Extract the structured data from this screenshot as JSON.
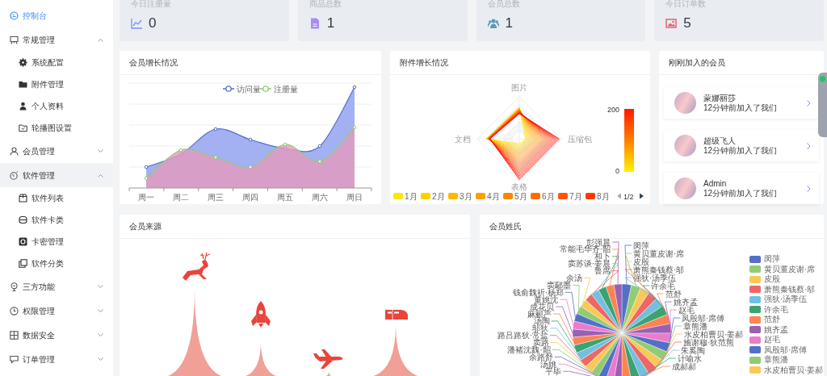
{
  "sidebar": {
    "items": [
      {
        "label": "控制台",
        "selected": true,
        "hovered": false
      },
      {
        "label": "常规管理",
        "selected": false,
        "hovered": false,
        "expanded": true,
        "children": [
          {
            "label": "系统配置",
            "selected": false
          },
          {
            "label": "附件管理",
            "selected": false
          },
          {
            "label": "个人资料",
            "selected": false
          },
          {
            "label": "轮播图设置",
            "selected": false
          }
        ]
      },
      {
        "label": "会员管理",
        "selected": false,
        "hovered": false,
        "expanded": false
      },
      {
        "label": "软件管理",
        "selected": false,
        "hovered": true,
        "expanded": true,
        "children": [
          {
            "label": "软件列表",
            "selected": false
          },
          {
            "label": "软件卡类",
            "selected": false
          },
          {
            "label": "卡密管理",
            "selected": false
          },
          {
            "label": "软件分类",
            "selected": false
          }
        ]
      },
      {
        "label": "三方功能",
        "selected": false,
        "hovered": false,
        "expanded": false
      },
      {
        "label": "权限管理",
        "selected": false,
        "hovered": false,
        "expanded": false
      },
      {
        "label": "数据安全",
        "selected": false,
        "hovered": false,
        "expanded": false
      },
      {
        "label": "订单管理",
        "selected": false,
        "hovered": false,
        "expanded": false
      }
    ]
  },
  "stats": [
    {
      "title": "今日注册量",
      "value": "0"
    },
    {
      "title": "商品总数",
      "value": "1"
    },
    {
      "title": "会员总数",
      "value": "1"
    },
    {
      "title": "今日订单数",
      "value": "5"
    }
  ],
  "member_growth": {
    "title": "会员增长情况",
    "legend": [
      {
        "label": "访问量",
        "color": "#5470c6"
      },
      {
        "label": "注册量",
        "color": "#91cc75"
      }
    ],
    "categories": [
      "周一",
      "周二",
      "周三",
      "周四",
      "周五",
      "周六",
      "周日"
    ]
  },
  "attachment_growth": {
    "title": "附件增长情况",
    "indicators": [
      "图片",
      "压缩包",
      "表格",
      "文档"
    ],
    "visual_map": {
      "max": "200",
      "min": "0"
    },
    "legend": [
      {
        "label": "1月",
        "color": "#ffe600"
      },
      {
        "label": "2月",
        "color": "#ffd000"
      },
      {
        "label": "3月",
        "color": "#ffb800"
      },
      {
        "label": "4月",
        "color": "#ff9f00"
      },
      {
        "label": "5月",
        "color": "#ff8600"
      },
      {
        "label": "6月",
        "color": "#ff6d00"
      },
      {
        "label": "7月",
        "color": "#ff5500"
      },
      {
        "label": "8月",
        "color": "#ff3a00"
      }
    ],
    "legend_page": "1/2"
  },
  "new_members": {
    "title": "刚刚加入的会员",
    "items": [
      {
        "name": "蒙娜丽莎",
        "note": "12分钟前加入了我们"
      },
      {
        "name": "超级飞人",
        "note": "12分钟前加入了我们"
      },
      {
        "name": "Admin",
        "note": "12分钟前加入了我们"
      }
    ]
  },
  "member_sources": {
    "title": "会员来源"
  },
  "member_surnames": {
    "title": "会员姓氏",
    "labels_right": [
      "闵萍",
      "黄贝董皮谢·席",
      "皮殷",
      "萧熊秦钱蔡·邬",
      "强狄·汤季伍",
      "许余毛",
      "范舒",
      "姚齐孟",
      "赵毛",
      "凤殷邬·席傅",
      "章熊潘",
      "水皮柏曹贝·姜郝",
      "施谢穆·狄范熊",
      "朱奚陶",
      "计喻水",
      "成郝郝"
    ],
    "labels_left": [
      "彭强晨",
      "常能毛华齐·韶",
      "和卜",
      "窦苏谈·姜晨",
      "鲁席",
      "余汤",
      "窦鄢墨",
      "钱俞魏祈·杨郑",
      "董姚沈",
      "成花贝",
      "麻郦严",
      "汤陶",
      "邬狄",
      "路吕路狄·常盐",
      "窦路",
      "潘褚沈魏·韶",
      "余路舒",
      "汤姚",
      "平毕"
    ],
    "legend": [
      {
        "name": "闵萍",
        "color": "#5470c6"
      },
      {
        "name": "黄贝董皮谢·席",
        "color": "#91cc75"
      },
      {
        "name": "皮殷",
        "color": "#fac858"
      },
      {
        "name": "萧熊秦钱蔡·邬",
        "color": "#ee6666"
      },
      {
        "name": "强狄·汤季伍",
        "color": "#73c0de"
      },
      {
        "name": "许余毛",
        "color": "#3ba272"
      },
      {
        "name": "范舒",
        "color": "#fc8452"
      },
      {
        "name": "姚齐孟",
        "color": "#9a60b4"
      },
      {
        "name": "赵毛",
        "color": "#ea7ccc"
      },
      {
        "name": "凤殷邬·席傅",
        "color": "#5470c6"
      },
      {
        "name": "章熊潘",
        "color": "#91cc75"
      },
      {
        "name": "水皮柏曹贝·姜郝",
        "color": "#fac858"
      }
    ]
  }
}
